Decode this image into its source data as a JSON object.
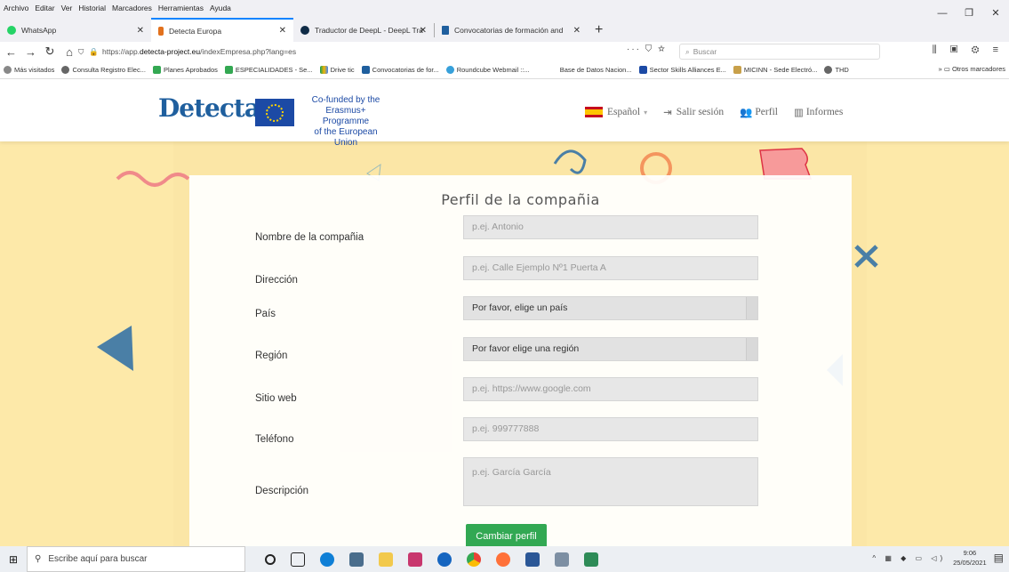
{
  "browser": {
    "menu": [
      "Archivo",
      "Editar",
      "Ver",
      "Historial",
      "Marcadores",
      "Herramientas",
      "Ayuda"
    ],
    "tabs": [
      {
        "label": "WhatsApp",
        "color": "#25d366"
      },
      {
        "label": "Detecta Europa",
        "color": "#e2711d"
      },
      {
        "label": "Traductor de DeepL - DeepL Tra",
        "color": "#0f2b46"
      },
      {
        "label": "Convocatorias de formación and",
        "color": "#1f5f9e"
      }
    ],
    "url_prefix": "https://app.",
    "url_domain": "detecta-project.eu",
    "url_path": "/indexEmpresa.php?lang=es",
    "search_placeholder": "Buscar",
    "bookmarks": [
      "Más visitados",
      "Consulta Registro Elec...",
      "Planes Aprobados",
      "ESPECIALIDADES - Se...",
      "Drive tic",
      "Convocatorias de for...",
      "Roundcube Webmail ::...",
      "Base de Datos Nacion...",
      "Sector Skills Alliances E...",
      "MICINN - Sede Electró...",
      "THD"
    ],
    "other_bookmarks": "Otros marcadores"
  },
  "site": {
    "logo": "Detecta",
    "eu_text": [
      "Co-funded by the",
      "Erasmus+ Programme",
      "of the European Union"
    ],
    "nav": {
      "language": "Español",
      "logout": "Salir sesión",
      "profile": "Perfil",
      "reports": "Informes"
    },
    "form": {
      "title": "Perfil de la compañia",
      "fields": [
        {
          "label": "Nombre de la compañia",
          "placeholder": "p.ej. Antonio"
        },
        {
          "label": "Dirección",
          "placeholder": "p.ej. Calle Ejemplo Nº1 Puerta A"
        },
        {
          "label": "País",
          "placeholder": "Por favor, elige un país"
        },
        {
          "label": "Región",
          "placeholder": "Por favor elige una región"
        },
        {
          "label": "Sitio web",
          "placeholder": "p.ej. https://www.google.com"
        },
        {
          "label": "Teléfono",
          "placeholder": "p.ej. 999777888"
        },
        {
          "label": "Descripción",
          "placeholder": "p.ej. García García"
        }
      ],
      "submit": "Cambiar perfil"
    }
  },
  "taskbar": {
    "search_placeholder": "Escribe aquí para buscar",
    "time": "9:06",
    "date": "25/05/2021"
  }
}
